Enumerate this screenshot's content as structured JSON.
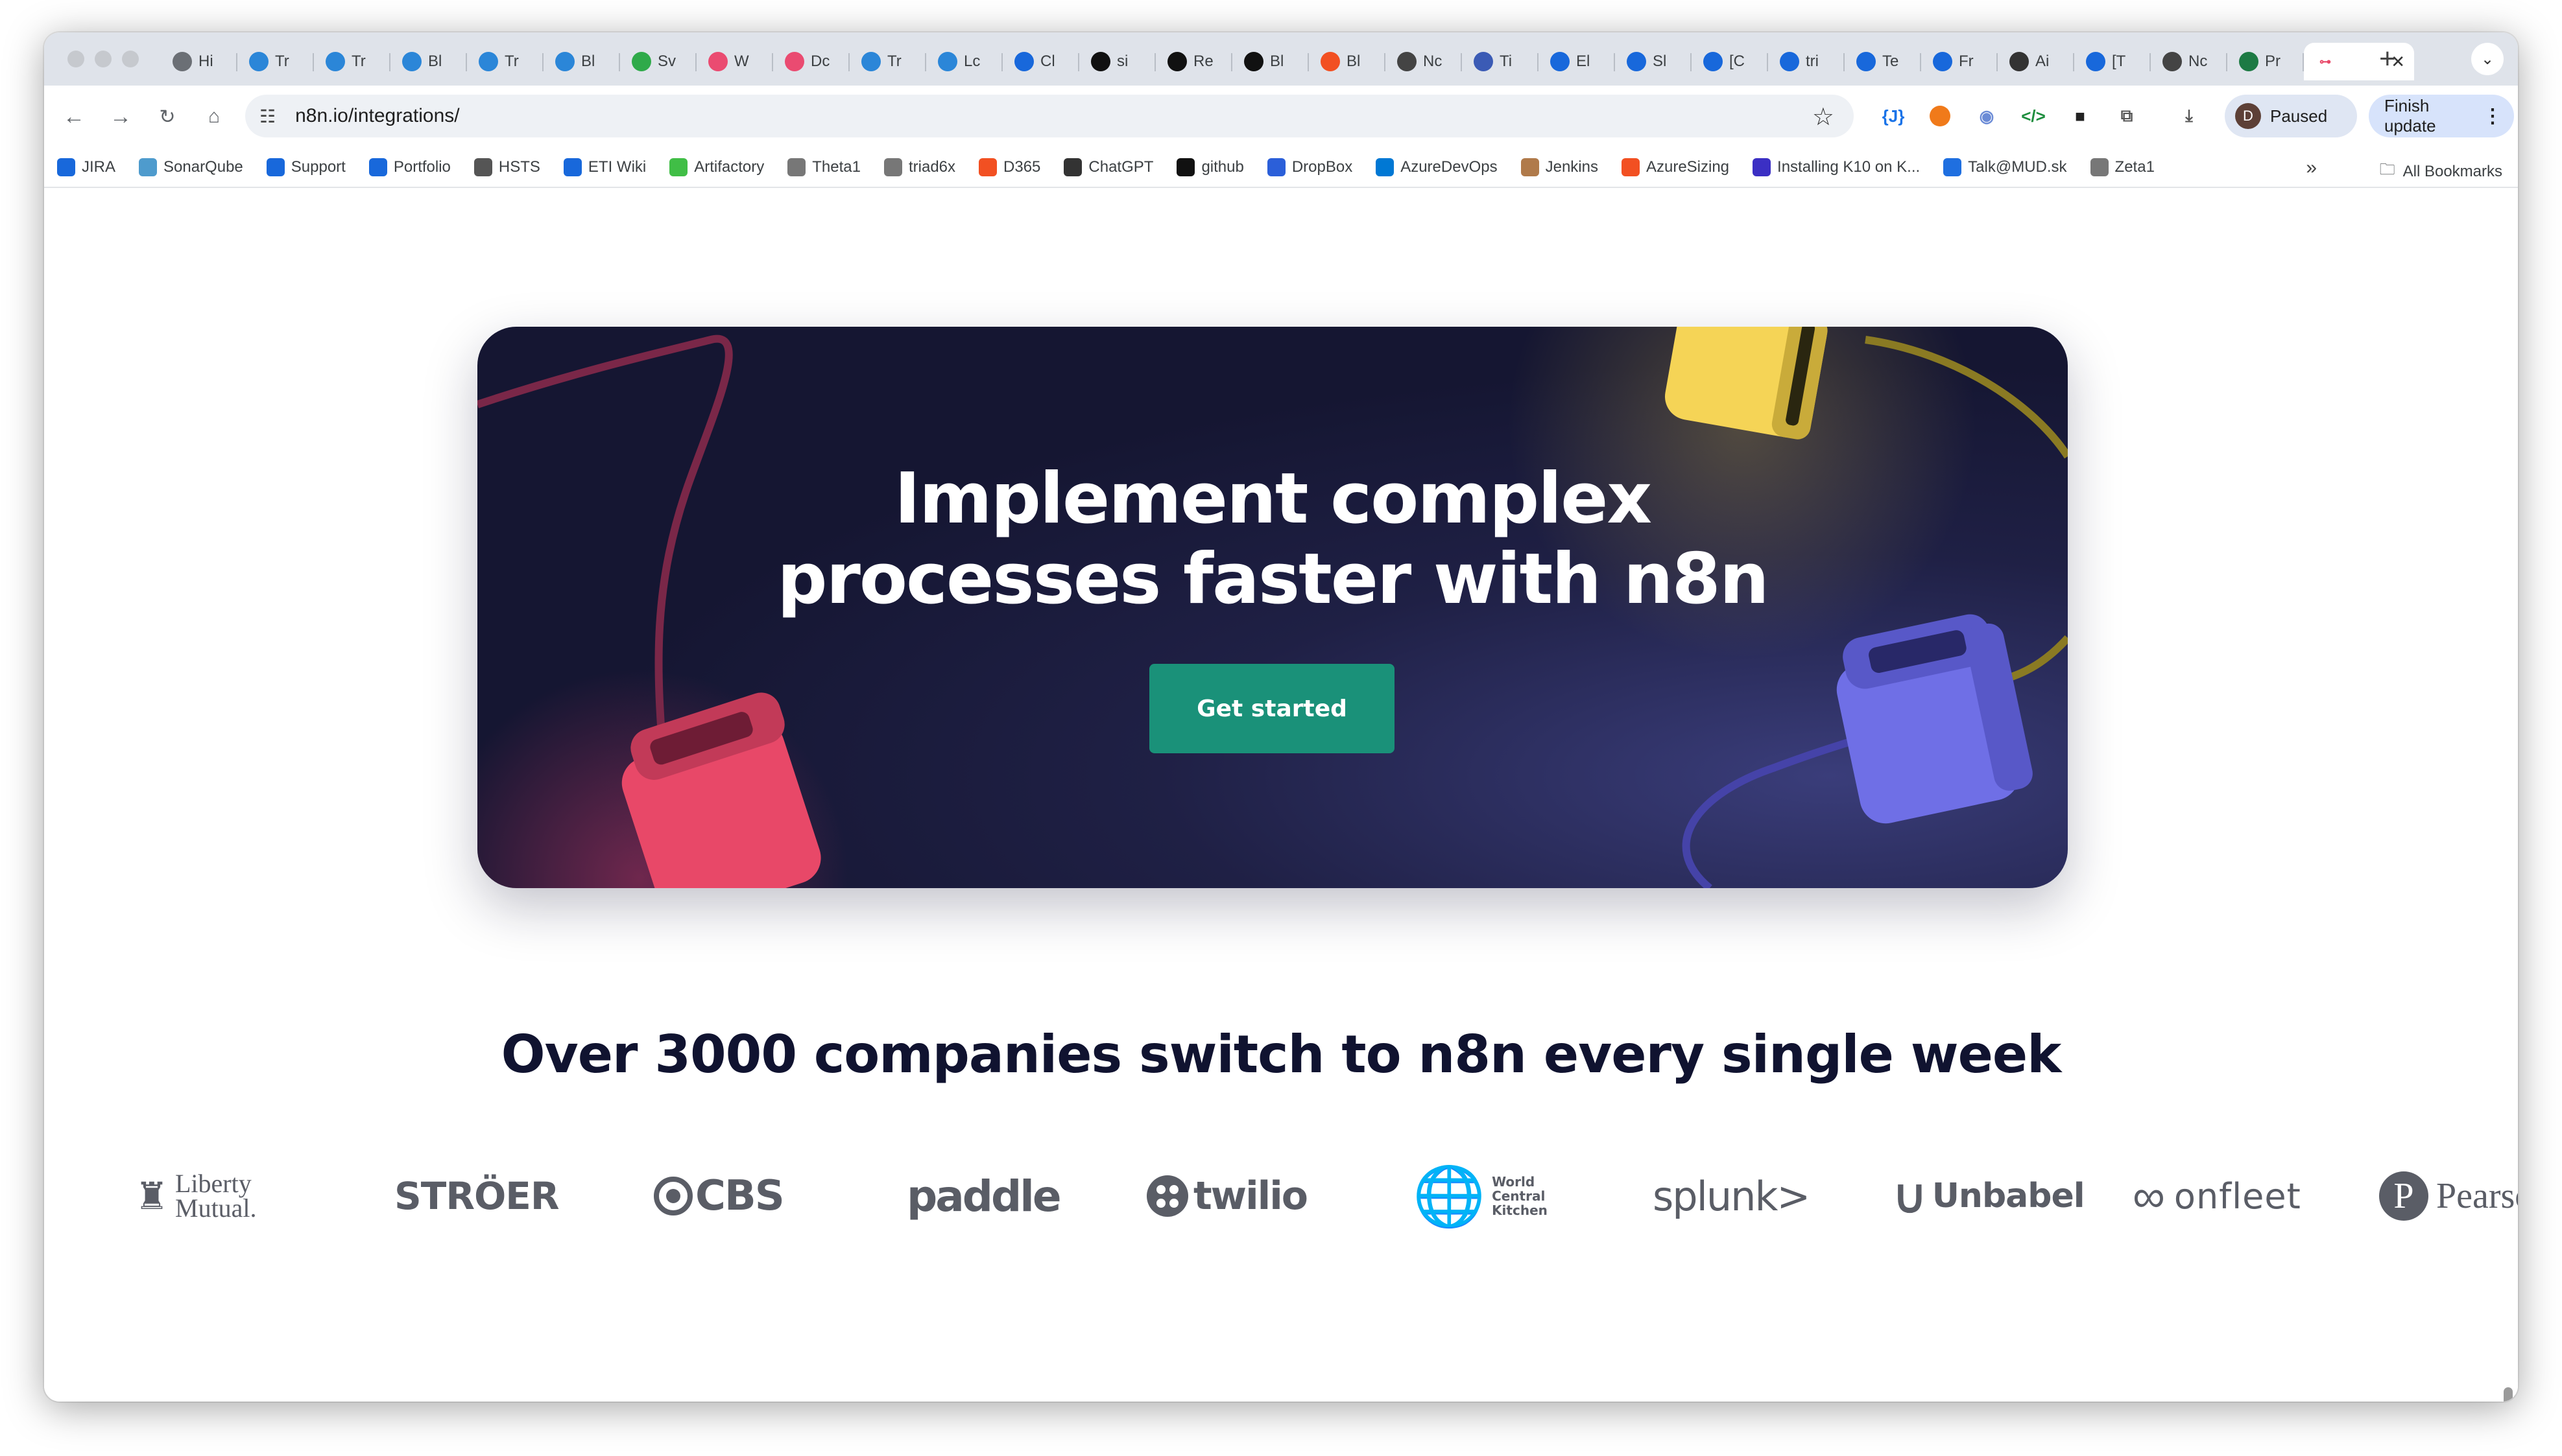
{
  "browser": {
    "tabs": [
      {
        "label": "Hi",
        "icon": "globe-icon",
        "color": "#6b6f75"
      },
      {
        "label": "Tr",
        "icon": "eti-icon",
        "color": "#2b86d8"
      },
      {
        "label": "Tr",
        "icon": "eti-icon",
        "color": "#2b86d8"
      },
      {
        "label": "Bl",
        "icon": "eti-icon",
        "color": "#2b86d8"
      },
      {
        "label": "Tr",
        "icon": "eti-icon",
        "color": "#2b86d8"
      },
      {
        "label": "Bl",
        "icon": "eti-icon",
        "color": "#2b86d8"
      },
      {
        "label": "Sv",
        "icon": "sv-icon",
        "color": "#2faa4a"
      },
      {
        "label": "W",
        "icon": "n8n-icon",
        "color": "#ea4b71"
      },
      {
        "label": "Dc",
        "icon": "n8n-icon",
        "color": "#ea4b71"
      },
      {
        "label": "Tr",
        "icon": "eti-icon",
        "color": "#2b86d8"
      },
      {
        "label": "Lc",
        "icon": "eti-icon",
        "color": "#2b86d8"
      },
      {
        "label": "Cl",
        "icon": "confluence-icon",
        "color": "#1868db"
      },
      {
        "label": "si",
        "icon": "github-icon",
        "color": "#111"
      },
      {
        "label": "Re",
        "icon": "github-icon",
        "color": "#111"
      },
      {
        "label": "Bl",
        "icon": "github-icon",
        "color": "#111"
      },
      {
        "label": "Bl",
        "icon": "microsoft-icon",
        "color": "#f25022"
      },
      {
        "label": "Nc",
        "icon": "globe-icon",
        "color": "#444"
      },
      {
        "label": "Ti",
        "icon": "globe-icon",
        "color": "#3b5bb5"
      },
      {
        "label": "El",
        "icon": "confluence-icon",
        "color": "#1868db"
      },
      {
        "label": "Sl",
        "icon": "confluence-icon",
        "color": "#1868db"
      },
      {
        "label": "[C",
        "icon": "jira-icon",
        "color": "#1868db"
      },
      {
        "label": "tri",
        "icon": "confluence-icon",
        "color": "#1868db"
      },
      {
        "label": "Te",
        "icon": "confluence-icon",
        "color": "#1868db"
      },
      {
        "label": "Fr",
        "icon": "confluence-icon",
        "color": "#1868db"
      },
      {
        "label": "Ai",
        "icon": "chatgpt-icon",
        "color": "#333"
      },
      {
        "label": "[T",
        "icon": "jira-icon",
        "color": "#1868db"
      },
      {
        "label": "Nc",
        "icon": "globe-icon",
        "color": "#444"
      },
      {
        "label": "Pr",
        "icon": "excel-icon",
        "color": "#1d7a44"
      }
    ],
    "active_tab_icon": "n8n-icon",
    "url": "n8n.io/integrations/",
    "profile_initial": "D",
    "profile_status": "Paused",
    "finish_update": "Finish update",
    "bookmarks": [
      {
        "label": "JIRA",
        "icon": "jira-icon",
        "color": "#1868db"
      },
      {
        "label": "SonarQube",
        "icon": "sonar-icon",
        "color": "#4e9bcd"
      },
      {
        "label": "Support",
        "icon": "jira-icon",
        "color": "#1868db"
      },
      {
        "label": "Portfolio",
        "icon": "jira-icon",
        "color": "#1868db"
      },
      {
        "label": "HSTS",
        "icon": "globe-icon",
        "color": "#555"
      },
      {
        "label": "ETI Wiki",
        "icon": "confluence-icon",
        "color": "#1868db"
      },
      {
        "label": "Artifactory",
        "icon": "artifactory-icon",
        "color": "#40be46"
      },
      {
        "label": "Theta1",
        "icon": "globe-icon",
        "color": "#777"
      },
      {
        "label": "triad6x",
        "icon": "globe-icon",
        "color": "#777"
      },
      {
        "label": "D365",
        "icon": "microsoft-icon",
        "color": "#f25022"
      },
      {
        "label": "ChatGPT",
        "icon": "chatgpt-icon",
        "color": "#333"
      },
      {
        "label": "github",
        "icon": "github-icon",
        "color": "#111"
      },
      {
        "label": "DropBox",
        "icon": "dropbox-icon",
        "color": "#2b5fd9"
      },
      {
        "label": "AzureDevOps",
        "icon": "azure-devops-icon",
        "color": "#0078d4"
      },
      {
        "label": "Jenkins",
        "icon": "jenkins-icon",
        "color": "#b07a4a"
      },
      {
        "label": "AzureSizing",
        "icon": "microsoft-icon",
        "color": "#f25022"
      },
      {
        "label": "Installing K10 on K...",
        "icon": "k-icon",
        "color": "#3b2fc4"
      },
      {
        "label": "Talk@MUD.sk",
        "icon": "power-icon",
        "color": "#1f6fe0"
      },
      {
        "label": "Zeta1",
        "icon": "globe-icon",
        "color": "#777"
      }
    ],
    "all_bookmarks": "All Bookmarks"
  },
  "page": {
    "hero": {
      "title_line1": "Implement complex",
      "title_line2": "processes faster with n8n",
      "cta": "Get started"
    },
    "subhead": "Over 3000 companies switch to n8n every single week",
    "logos": [
      {
        "name": "Liberty Mutual",
        "line1": "Liberty",
        "line2": "Mutual."
      },
      {
        "name": "STRÖER"
      },
      {
        "name": "CBS"
      },
      {
        "name": "paddle"
      },
      {
        "name": "twilio"
      },
      {
        "name": "World Central Kitchen",
        "line1": "World",
        "line2": "Central",
        "line3": "Kitchen"
      },
      {
        "name": "splunk>"
      },
      {
        "name": "Unbabel"
      },
      {
        "name": "onfleet"
      },
      {
        "name": "Pearso"
      }
    ]
  },
  "colors": {
    "hero_bg": "#151632",
    "cta_bg": "#1a9179",
    "heading": "#101330",
    "cube_pink": "#e84868",
    "cube_yellow": "#f5d456",
    "cube_purple": "#6f6fe6"
  }
}
